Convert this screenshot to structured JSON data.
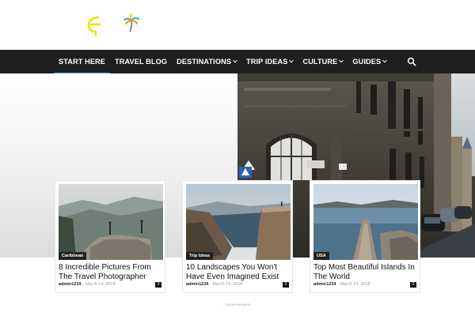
{
  "nav": {
    "items": [
      {
        "label": "START HERE",
        "dropdown": false,
        "active": true
      },
      {
        "label": "TRAVEL BLOG",
        "dropdown": false,
        "active": false
      },
      {
        "label": "DESTINATIONS",
        "dropdown": true,
        "active": false
      },
      {
        "label": "TRIP IDEAS",
        "dropdown": true,
        "active": false
      },
      {
        "label": "CULTURE",
        "dropdown": true,
        "active": false
      },
      {
        "label": "GUIDES",
        "dropdown": true,
        "active": false
      }
    ],
    "search_icon": "search-icon",
    "active_color": "#4db2ec",
    "bar_color": "#1e1e1e"
  },
  "cards": [
    {
      "category": "Caribbean",
      "title": "8 Incredible Pictures From The Travel Photographer",
      "author": "admin1234",
      "date": "March 14, 2018",
      "comments": "0"
    },
    {
      "category": "Trip Ideas",
      "title": "10 Landscapes You Won't Have Even Imagined Exist",
      "author": "admin1234",
      "date": "March 14, 2018",
      "comments": "0"
    },
    {
      "category": "USA",
      "title": "Top Most Beautiful Islands In The World",
      "author": "admin1234",
      "date": "March 14, 2018",
      "comments": "0"
    }
  ],
  "advertisement": "- Advertisement -"
}
